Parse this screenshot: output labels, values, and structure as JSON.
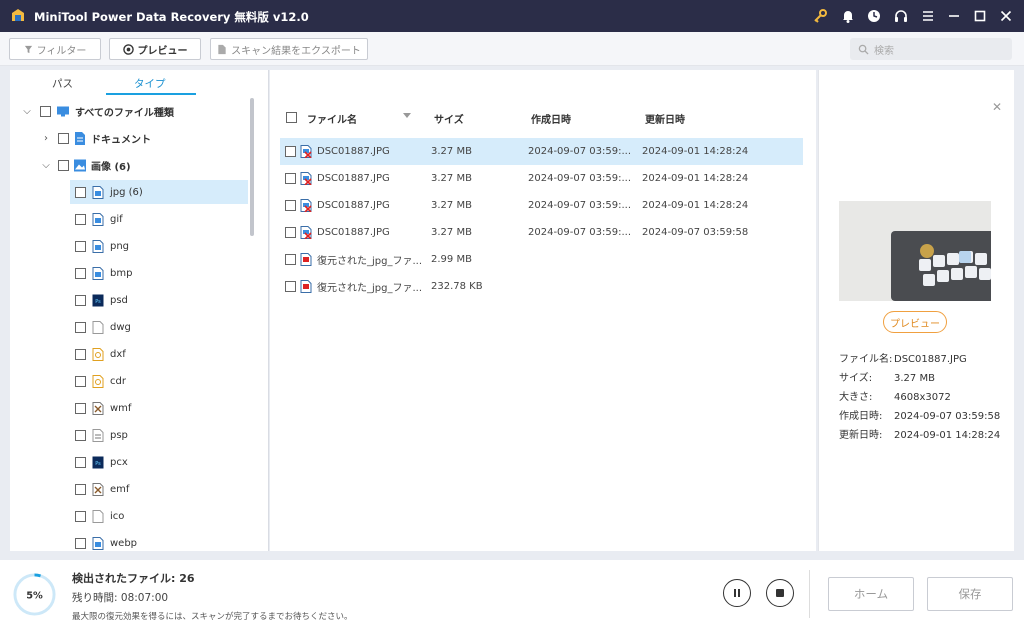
{
  "app": {
    "title": "MiniTool Power Data Recovery 無料版 v12.0"
  },
  "toolbar": {
    "filter_label": "フィルター",
    "preview_label": "プレビュー",
    "export_label": "スキャン結果をエクスポート",
    "search_placeholder": "検索"
  },
  "left": {
    "tabs": [
      {
        "label": "パス"
      },
      {
        "label": "タイプ"
      }
    ],
    "tree": {
      "all_label": "すべてのファイル種類",
      "documents_label": "ドキュメント",
      "images_label": "画像 (6)",
      "children": [
        {
          "label": "jpg (6)",
          "icon": "jpg-file-icon"
        },
        {
          "label": "gif",
          "icon": "gif-file-icon"
        },
        {
          "label": "png",
          "icon": "png-file-icon"
        },
        {
          "label": "bmp",
          "icon": "bmp-file-icon"
        },
        {
          "label": "psd",
          "icon": "psd-file-icon"
        },
        {
          "label": "dwg",
          "icon": "dwg-file-icon"
        },
        {
          "label": "dxf",
          "icon": "dxf-file-icon"
        },
        {
          "label": "cdr",
          "icon": "cdr-file-icon"
        },
        {
          "label": "wmf",
          "icon": "wmf-file-icon"
        },
        {
          "label": "psp",
          "icon": "psp-file-icon"
        },
        {
          "label": "pcx",
          "icon": "pcx-file-icon"
        },
        {
          "label": "emf",
          "icon": "emf-file-icon"
        },
        {
          "label": "ico",
          "icon": "ico-file-icon"
        },
        {
          "label": "webp",
          "icon": "webp-file-icon"
        }
      ]
    }
  },
  "files": {
    "headers": {
      "name": "ファイル名",
      "size": "サイズ",
      "created": "作成日時",
      "modified": "更新日時"
    },
    "rows": [
      {
        "name": "DSC01887.JPG",
        "size": "3.27 MB",
        "created": "2024-09-07 03:59:...",
        "modified": "2024-09-01 14:28:24"
      },
      {
        "name": "DSC01887.JPG",
        "size": "3.27 MB",
        "created": "2024-09-07 03:59:...",
        "modified": "2024-09-01 14:28:24"
      },
      {
        "name": "DSC01887.JPG",
        "size": "3.27 MB",
        "created": "2024-09-07 03:59:...",
        "modified": "2024-09-01 14:28:24"
      },
      {
        "name": "DSC01887.JPG",
        "size": "3.27 MB",
        "created": "2024-09-07 03:59:...",
        "modified": "2024-09-07 03:59:58"
      },
      {
        "name": "復元された_jpg_ファ...",
        "size": "2.99 MB",
        "created": "",
        "modified": ""
      },
      {
        "name": "復元された_jpg_ファ...",
        "size": "232.78 KB",
        "created": "",
        "modified": ""
      }
    ]
  },
  "preview": {
    "button_label": "プレビュー",
    "info": [
      {
        "key": "ファイル名:",
        "value": "DSC01887.JPG"
      },
      {
        "key": "サイズ:",
        "value": "3.27 MB"
      },
      {
        "key": "大きさ:",
        "value": "4608x3072"
      },
      {
        "key": "作成日時:",
        "value": "2024-09-07 03:59:58"
      },
      {
        "key": "更新日時:",
        "value": "2024-09-01 14:28:24"
      }
    ]
  },
  "status": {
    "progress_label": "5%",
    "progress": 0.05,
    "found_label": "検出されたファイル:",
    "found_count": "26",
    "remaining_label": "残り時間:",
    "remaining_time": "08:07:00",
    "note": "最大限の復元効果を得るには、スキャンが完了するまでお待ちください。"
  },
  "actions": {
    "home_label": "ホーム",
    "save_label": "保存"
  },
  "colors": {
    "accent": "#1aa0e0",
    "titlebar": "#2b2d48",
    "selection": "#d6ecfb",
    "orange": "#f0a040"
  }
}
